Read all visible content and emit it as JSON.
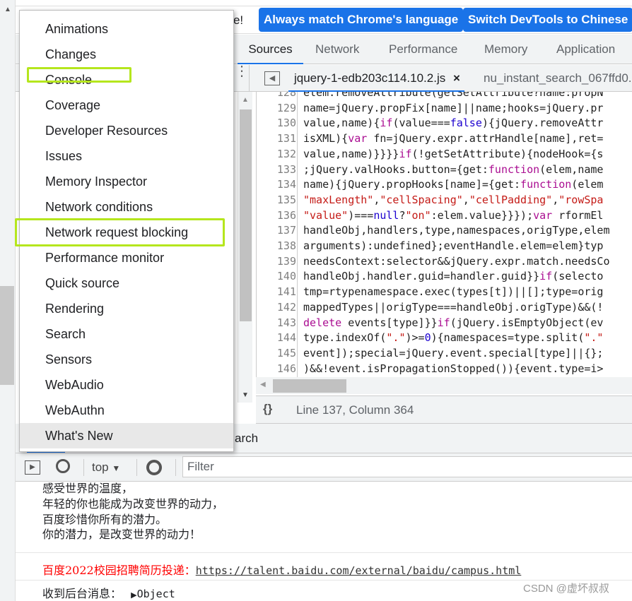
{
  "infobar": {
    "message_tail": "ese!",
    "btn_match": "Always match Chrome's language",
    "btn_switch": "Switch DevTools to Chinese"
  },
  "tabs": [
    "Sources",
    "Network",
    "Performance",
    "Memory",
    "Application"
  ],
  "editor_tabs": [
    {
      "label": "jquery-1-edb203c114.10.2.js",
      "close": "×"
    },
    {
      "label": "nu_instant_search_067ffd0."
    }
  ],
  "code_lines": [
    {
      "n": "128",
      "seg": [
        [
          "elem.removeAttribute(getSetAttribute?name:propN",
          ""
        ]
      ]
    },
    {
      "n": "129",
      "seg": [
        [
          "name=jQuery.propFix[name]||name;hooks=jQuery.pr",
          ""
        ]
      ]
    },
    {
      "n": "130",
      "seg": [
        [
          "value,name){",
          ""
        ],
        [
          "if",
          "kw"
        ],
        [
          "(value===",
          ""
        ],
        [
          "false",
          "lit"
        ],
        [
          "){jQuery.removeAttr",
          ""
        ]
      ]
    },
    {
      "n": "131",
      "seg": [
        [
          "isXML){",
          ""
        ],
        [
          "var",
          "kw"
        ],
        [
          " fn=jQuery.expr.attrHandle[name],ret=",
          ""
        ]
      ]
    },
    {
      "n": "132",
      "seg": [
        [
          "value,name)}}}}",
          ""
        ],
        [
          "if",
          "kw"
        ],
        [
          "(!getSetAttribute){nodeHook={s",
          ""
        ]
      ]
    },
    {
      "n": "133",
      "seg": [
        [
          ";jQuery.valHooks.button={get:",
          ""
        ],
        [
          "function",
          "kw"
        ],
        [
          "(elem,name",
          ""
        ]
      ]
    },
    {
      "n": "134",
      "seg": [
        [
          "name){jQuery.propHooks[name]={get:",
          ""
        ],
        [
          "function",
          "kw"
        ],
        [
          "(elem",
          ""
        ]
      ]
    },
    {
      "n": "135",
      "seg": [
        [
          "\"maxLength\"",
          "str"
        ],
        [
          ",",
          ""
        ],
        [
          "\"cellSpacing\"",
          "str"
        ],
        [
          ",",
          ""
        ],
        [
          "\"cellPadding\"",
          "str"
        ],
        [
          ",",
          ""
        ],
        [
          "\"rowSpa",
          "str"
        ]
      ]
    },
    {
      "n": "136",
      "seg": [
        [
          "\"value\"",
          "str"
        ],
        [
          ")===",
          ""
        ],
        [
          "null",
          "lit"
        ],
        [
          "?",
          ""
        ],
        [
          "\"on\"",
          "str"
        ],
        [
          ":elem.value}}});",
          ""
        ],
        [
          "var",
          "kw"
        ],
        [
          " rformEl",
          ""
        ]
      ]
    },
    {
      "n": "137",
      "seg": [
        [
          "handleObj,handlers,type,namespaces,origType,elem",
          ""
        ]
      ]
    },
    {
      "n": "138",
      "seg": [
        [
          "arguments):undefined};eventHandle.elem=elem}typ",
          ""
        ]
      ]
    },
    {
      "n": "139",
      "seg": [
        [
          "needsContext:selector&&jQuery.expr.match.needsCo",
          ""
        ]
      ]
    },
    {
      "n": "140",
      "seg": [
        [
          "handleObj.handler.guid=handler.guid}}",
          ""
        ],
        [
          "if",
          "kw"
        ],
        [
          "(selecto",
          ""
        ]
      ]
    },
    {
      "n": "141",
      "seg": [
        [
          "tmp=rtypenamespace.exec(types[t])||[];type=orig",
          ""
        ]
      ]
    },
    {
      "n": "142",
      "seg": [
        [
          "mappedTypes||origType===handleObj.origType)&&(!",
          ""
        ]
      ]
    },
    {
      "n": "143",
      "seg": [
        [
          "delete",
          "kw"
        ],
        [
          " events[type]}}",
          ""
        ],
        [
          "if",
          "kw"
        ],
        [
          "(jQuery.isEmptyObject(ev",
          ""
        ]
      ]
    },
    {
      "n": "144",
      "seg": [
        [
          "type.indexOf(",
          ""
        ],
        [
          "\".\"",
          "str"
        ],
        [
          ")>=",
          ""
        ],
        [
          "0",
          "lit"
        ],
        [
          "){namespaces=type.split(",
          ""
        ],
        [
          "\".\"",
          "str"
        ]
      ]
    },
    {
      "n": "145",
      "seg": [
        [
          "event]);special=jQuery.event.special[type]||{};",
          ""
        ]
      ]
    },
    {
      "n": "146",
      "seg": [
        [
          ")&&!event.isPropagationStopped()){event.type=i>",
          ""
        ]
      ]
    }
  ],
  "status": {
    "braces": "{}",
    "position": "Line 137, Column 364"
  },
  "drawer": {
    "search_tab_tail": "arch"
  },
  "console_toolbar": {
    "context": "top",
    "filter_placeholder": "Filter"
  },
  "console": {
    "lines": [
      "感受世界的温度，",
      "年轻的你也能成为改变世界的动力，",
      "百度珍惜你所有的潜力。",
      "你的潜力，是改变世界的动力！"
    ],
    "recruit_label": "百度2022校园招聘简历投递：",
    "recruit_url": "https://talent.baidu.com/external/baidu/campus.html",
    "msg_label": "收到后台消息：",
    "msg_object": "Object"
  },
  "menu": {
    "items": [
      "Animations",
      "Changes",
      "Console",
      "Coverage",
      "Developer Resources",
      "Issues",
      "Memory Inspector",
      "Network conditions",
      "Network request blocking",
      "Performance monitor",
      "Quick source",
      "Rendering",
      "Search",
      "Sensors",
      "WebAudio",
      "WebAuthn",
      "What's New"
    ],
    "highlighted": "What's New",
    "annotated": [
      "Console",
      "Network request blocking"
    ]
  },
  "watermark": "CSDN @虚坏叔叔",
  "colors": {
    "accent": "#1a73e8",
    "keyword": "#aa0d91",
    "string": "#c41a16",
    "literal": "#1c00cf",
    "annotation": "#b5e61d",
    "recruit": "#ff0000"
  }
}
